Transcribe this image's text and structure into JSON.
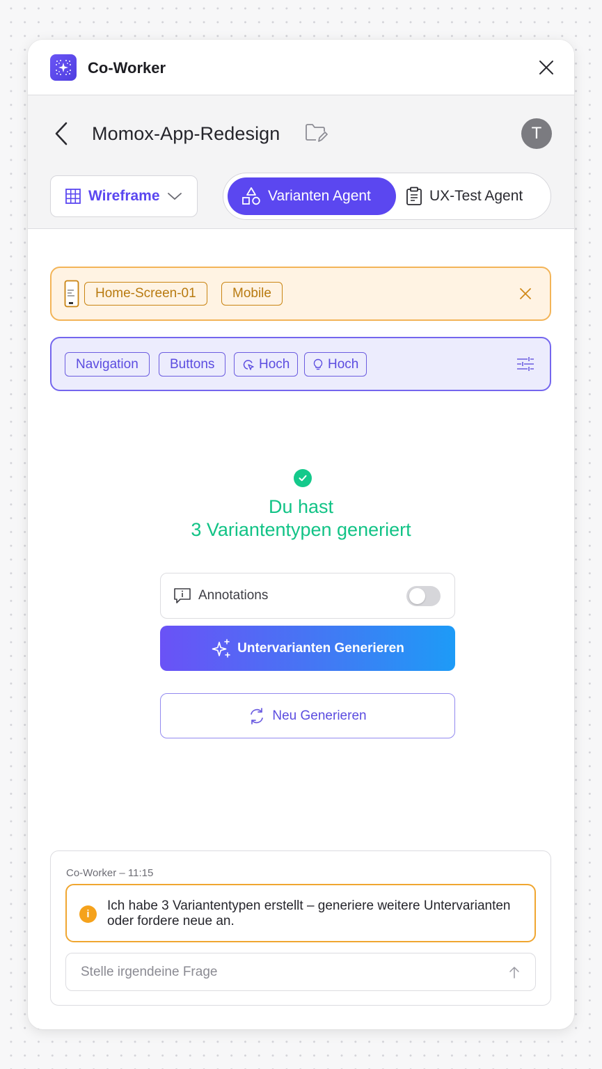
{
  "app": {
    "title": "Co-Worker"
  },
  "header": {
    "project_title": "Momox-App-Redesign",
    "avatar_initial": "T",
    "mode_label": "Wireframe",
    "agents": [
      {
        "label": "Varianten Agent",
        "active": true
      },
      {
        "label": "UX-Test Agent",
        "active": false
      }
    ]
  },
  "context": {
    "chips": [
      "Home-Screen-01",
      "Mobile"
    ]
  },
  "filters": {
    "chips": [
      {
        "label": "Navigation",
        "icon": ""
      },
      {
        "label": "Buttons",
        "icon": ""
      },
      {
        "label": "Hoch",
        "icon": "cursor-icon"
      },
      {
        "label": "Hoch",
        "icon": "lightbulb-icon"
      }
    ]
  },
  "result": {
    "line1": "Du hast",
    "line2": "3 Variantentypen generiert"
  },
  "annotations": {
    "label": "Annotations",
    "enabled": false
  },
  "actions": {
    "generate_label": "Untervarianten Generieren",
    "regenerate_label": "Neu Generieren"
  },
  "chat": {
    "meta": "Co-Worker – 11:15",
    "message": "Ich habe 3 Variantentypen erstellt – generiere weitere Untervarianten oder fordere neue an.",
    "input_placeholder": "Stelle irgendeine Frage"
  },
  "colors": {
    "accent": "#5b47f0",
    "success": "#12c386",
    "warning": "#f0a630",
    "context_bg": "#fff3e3",
    "filter_bg": "#ececfd"
  }
}
